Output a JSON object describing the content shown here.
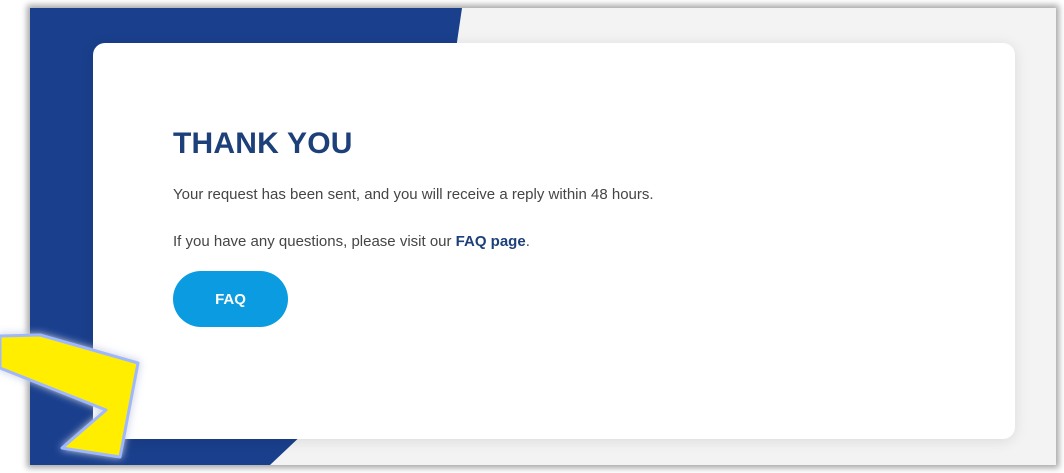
{
  "colors": {
    "brand_blue": "#1a3f8c",
    "heading": "#1d3f7a",
    "button": "#0a9be0",
    "arrow": "#ffee00"
  },
  "card": {
    "title": "THANK YOU",
    "message_line": "Your request has been sent, and you will receive a reply within 48 hours.",
    "faq_prefix": "If you have any questions, please visit our ",
    "faq_link_label": "FAQ page",
    "faq_suffix": ".",
    "faq_button_label": "FAQ"
  },
  "annotation": {
    "icon": "arrow-pointer-icon"
  }
}
